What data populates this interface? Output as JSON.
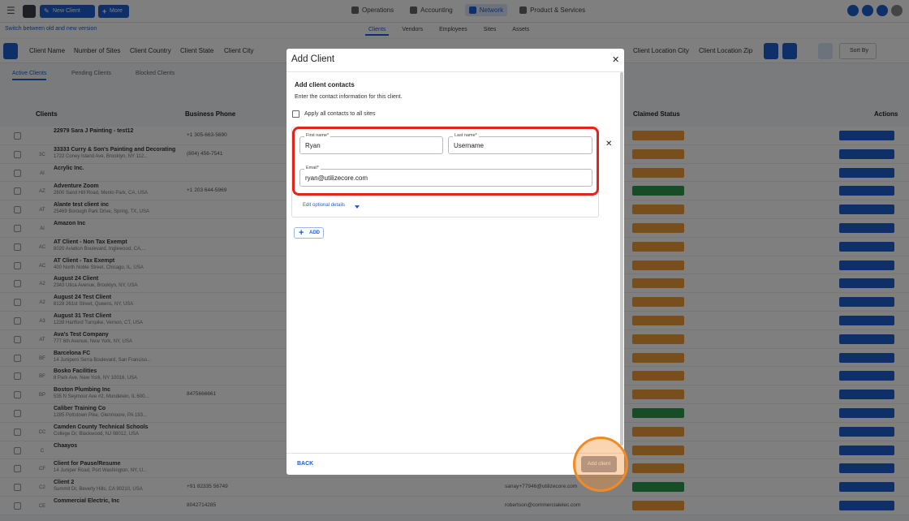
{
  "app": {
    "new_client_label": "New Client",
    "more_label": "More",
    "nav": [
      {
        "label": "Operations",
        "active": false
      },
      {
        "label": "Accounting",
        "active": false
      },
      {
        "label": "Network",
        "active": true
      },
      {
        "label": "Product & Services",
        "active": false
      }
    ],
    "subnav": {
      "hint": "Switch between old and new version",
      "tabs": [
        {
          "label": "Clients",
          "active": true
        },
        {
          "label": "Vendors",
          "active": false
        },
        {
          "label": "Employees",
          "active": false
        },
        {
          "label": "Sites",
          "active": false
        },
        {
          "label": "Assets",
          "active": false
        }
      ]
    },
    "columns": [
      "Client Name",
      "Number of Sites",
      "Client Country",
      "Client State",
      "Client City",
      "Client Location City",
      "Client Location Zip"
    ],
    "sort_label": "Sort By",
    "list_tabs": [
      {
        "label": "Active Clients",
        "active": true
      },
      {
        "label": "Pending Clients",
        "active": false
      },
      {
        "label": "Blocked Clients",
        "active": false
      }
    ],
    "table_headers": {
      "clients": "Clients",
      "phone": "Business Phone",
      "claimed": "Claimed Status",
      "actions": "Actions"
    },
    "rows": [
      {
        "initials": "",
        "name": "22979 Sara J Painting - test12",
        "address": "",
        "phone": "+1 305-663-5690",
        "email": "",
        "status": "pending"
      },
      {
        "initials": "3C",
        "name": "33333 Curry & Son's Painting and Decorating",
        "address": "1722 Coney Island Ave, Brooklyn, NY 112...",
        "phone": "(804) 456-7541",
        "email": "",
        "status": "pending"
      },
      {
        "initials": "AI",
        "name": "Acrylic Inc.",
        "address": "",
        "phone": "",
        "email": "",
        "status": "pending"
      },
      {
        "initials": "AZ",
        "name": "Adventure Zoom",
        "address": "2600 Sand Hill Road, Menlo Park, CA, USA",
        "phone": "+1 203 644-5969",
        "email": "",
        "status": "ok"
      },
      {
        "initials": "AT",
        "name": "Alante test client inc",
        "address": "25469 Borough Park Drive, Spring, TX, USA",
        "phone": "",
        "email": "",
        "status": "pending"
      },
      {
        "initials": "AI",
        "name": "Amazon Inc",
        "address": "",
        "phone": "",
        "email": "",
        "status": "pending"
      },
      {
        "initials": "AC",
        "name": "AT Client - Non Tax Exempt",
        "address": "8020 Aviation Boulevard, Inglewood, CA,...",
        "phone": "",
        "email": "",
        "status": "pending"
      },
      {
        "initials": "AC",
        "name": "AT Client - Tax Exempt",
        "address": "400 North Noble Street, Chicago, IL, USA",
        "phone": "",
        "email": "",
        "status": "pending"
      },
      {
        "initials": "A2",
        "name": "August 24 Client",
        "address": "2343 Utica Avenue, Brooklyn, NY, USA",
        "phone": "",
        "email": "",
        "status": "pending"
      },
      {
        "initials": "A2",
        "name": "August 24 Test Client",
        "address": "8128 261st Street, Queens, NY, USA",
        "phone": "",
        "email": "",
        "status": "pending"
      },
      {
        "initials": "A3",
        "name": "August 31 Test Client",
        "address": "1239 Hartford Turnpike, Vernon, CT, USA",
        "phone": "",
        "email": "",
        "status": "pending"
      },
      {
        "initials": "AT",
        "name": "Ava's Test Company",
        "address": "777 6th Avenue, New York, NY, USA",
        "phone": "",
        "email": "",
        "status": "pending"
      },
      {
        "initials": "BF",
        "name": "Barcelona FC",
        "address": "14 Junipero Serra Boulevard, San Franciso...",
        "phone": "",
        "email": "",
        "status": "pending"
      },
      {
        "initials": "BF",
        "name": "Bosko Facilities",
        "address": "8 Park Ave, New York, NY 10016, USA",
        "phone": "",
        "email": "",
        "status": "pending"
      },
      {
        "initials": "BP",
        "name": "Boston Plumbing Inc",
        "address": "535 N Seymour Ave #2, Mundelein, IL 600...",
        "phone": "8475666661",
        "email": "",
        "status": "pending"
      },
      {
        "initials": "",
        "name": "Caliber Training Co",
        "address": "1285 Pottstown Pike, Glenmoore, PA 193...",
        "phone": "",
        "email": "",
        "status": "ok"
      },
      {
        "initials": "CC",
        "name": "Camden County Technical Schools",
        "address": "College Dr, Blackwood, NJ 08012, USA",
        "phone": "",
        "email": "",
        "status": "pending"
      },
      {
        "initials": "C",
        "name": "Chaayos",
        "address": "",
        "phone": "",
        "email": "",
        "status": "pending"
      },
      {
        "initials": "CF",
        "name": "Client for Pause/Resume",
        "address": "14 Juniper Road, Port Washington, NY, U...",
        "phone": "",
        "email": "",
        "status": "pending"
      },
      {
        "initials": "C2",
        "name": "Client 2",
        "address": "Summit Dr, Beverly Hills, CA 90210, USA",
        "phone": "+91 82335 56749",
        "email": "sanay+77946@utilizecore.com",
        "status": "ok"
      },
      {
        "initials": "CE",
        "name": "Commercial Electric, Inc",
        "address": "",
        "phone": "8042714285",
        "email": "robertson@commercialelec.com",
        "status": "pending"
      }
    ]
  },
  "modal": {
    "title": "Add Client",
    "close_icon": "close-icon",
    "section_title": "Add client contacts",
    "section_desc": "Enter the contact information for this client.",
    "apply_all_label": "Apply all contacts to all sites",
    "contact": {
      "first_name_label": "First name*",
      "first_name_value": "Ryan",
      "last_name_label": "Last name*",
      "last_name_value": "Username",
      "email_label": "Email*",
      "email_value": "ryan@utilizecore.com"
    },
    "optional_label": "Edit optional details",
    "add_label": "ADD",
    "back_label": "BACK",
    "submit_label": "Add client"
  },
  "colors": {
    "primary": "#1f5fd1",
    "highlight": "#e1251b",
    "click_ring": "#f18a25",
    "status_pending": "#f39c3b",
    "status_ok": "#2e9b4d"
  }
}
